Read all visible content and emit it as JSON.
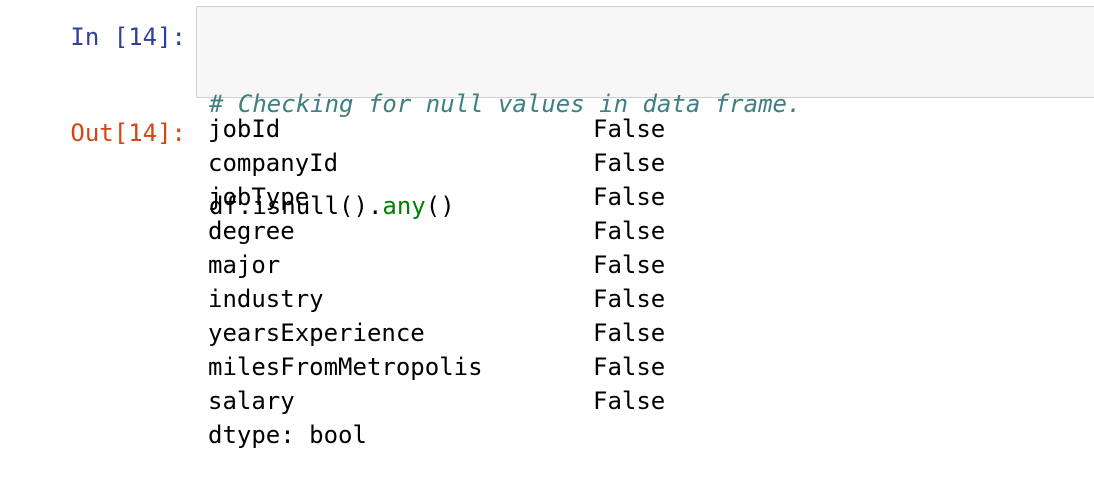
{
  "input_cell": {
    "prompt": "In [14]:",
    "comment": "# Checking for null values in data frame.",
    "code_prefix": "df.isnull().",
    "code_builtin": "any",
    "code_suffix": "()"
  },
  "output_cell": {
    "prompt": "Out[14]:",
    "rows": [
      {
        "name": "jobId",
        "value": "False"
      },
      {
        "name": "companyId",
        "value": "False"
      },
      {
        "name": "jobType",
        "value": "False"
      },
      {
        "name": "degree",
        "value": "False"
      },
      {
        "name": "major",
        "value": "False"
      },
      {
        "name": "industry",
        "value": "False"
      },
      {
        "name": "yearsExperience",
        "value": "False"
      },
      {
        "name": "milesFromMetropolis",
        "value": "False"
      },
      {
        "name": "salary",
        "value": "False"
      }
    ],
    "dtype": "dtype: bool"
  },
  "colors": {
    "in_prompt": "#303f9f",
    "out_prompt": "#d84315",
    "comment": "#408080",
    "builtin": "#008000",
    "input_bg": "#f7f7f7",
    "input_border": "#cfcfcf"
  }
}
